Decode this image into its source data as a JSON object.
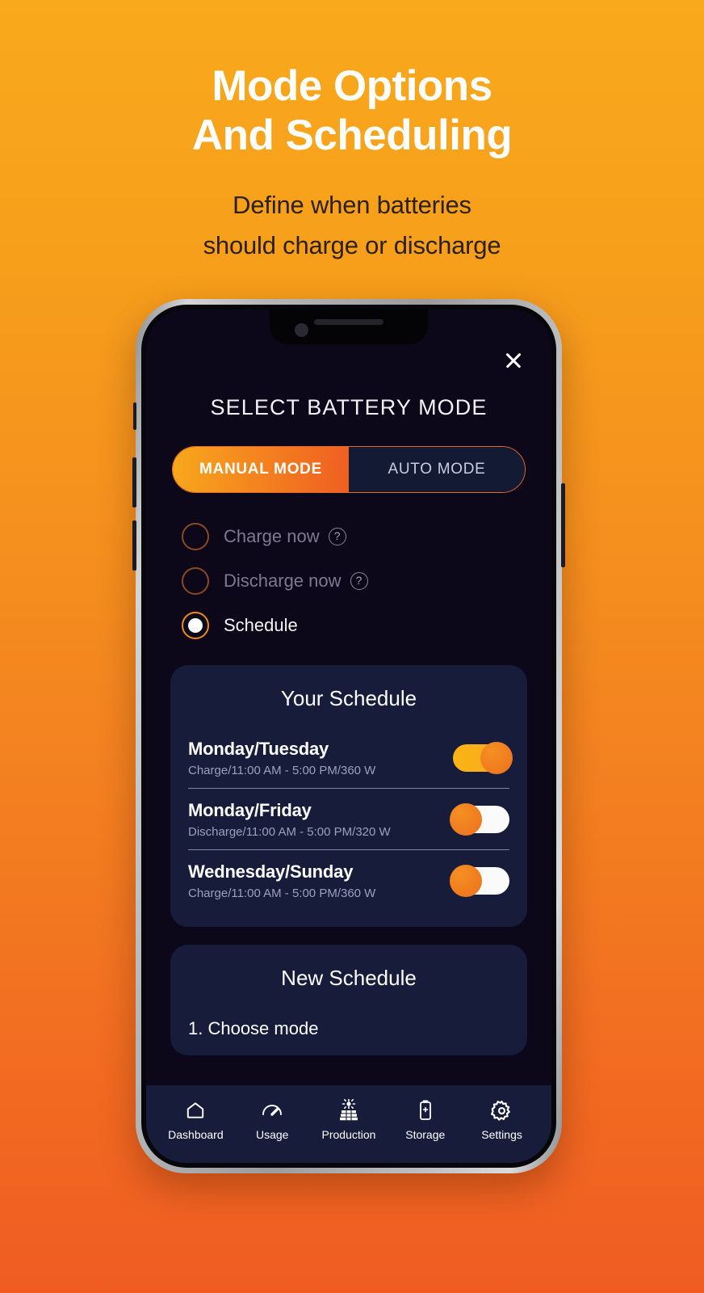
{
  "hero": {
    "title_line1": "Mode Options",
    "title_line2": "And Scheduling",
    "subtitle_line1": "Define when batteries",
    "subtitle_line2": "should charge or discharge"
  },
  "colors": {
    "bg_top": "#F9A91C",
    "bg_bottom": "#F05C22",
    "accent_amber": "#F8A81C",
    "accent_orange": "#EF5E22",
    "screen_bg": "#0C0719",
    "card_bg": "#161C3A"
  },
  "phone": {
    "screen": {
      "close_icon": "close-icon",
      "title": "SELECT BATTERY MODE",
      "mode_switch": {
        "options": [
          {
            "label": "MANUAL MODE",
            "active": true
          },
          {
            "label": "AUTO MODE",
            "active": false
          }
        ]
      },
      "radio_options": [
        {
          "label": "Charge now",
          "selected": false,
          "has_help": true,
          "help_icon": "help-circle-icon"
        },
        {
          "label": "Discharge now",
          "selected": false,
          "has_help": true,
          "help_icon": "help-circle-icon"
        },
        {
          "label": "Schedule",
          "selected": true,
          "has_help": false,
          "help_icon": ""
        }
      ],
      "your_schedule": {
        "title": "Your Schedule",
        "rows": [
          {
            "days": "Monday/Tuesday",
            "detail": "Charge/11:00 AM - 5:00 PM/360 W",
            "enabled": true
          },
          {
            "days": "Monday/Friday",
            "detail": "Discharge/11:00 AM - 5:00 PM/320 W",
            "enabled": false
          },
          {
            "days": "Wednesday/Sunday",
            "detail": "Charge/11:00 AM - 5:00 PM/360 W",
            "enabled": false
          }
        ]
      },
      "new_schedule": {
        "title": "New Schedule",
        "step1": "1. Choose mode"
      },
      "navbar": [
        {
          "label": "Dashboard",
          "icon": "home-icon"
        },
        {
          "label": "Usage",
          "icon": "gauge-icon"
        },
        {
          "label": "Production",
          "icon": "solar-panel-icon"
        },
        {
          "label": "Storage",
          "icon": "battery-icon"
        },
        {
          "label": "Settings",
          "icon": "gear-icon"
        }
      ]
    }
  }
}
